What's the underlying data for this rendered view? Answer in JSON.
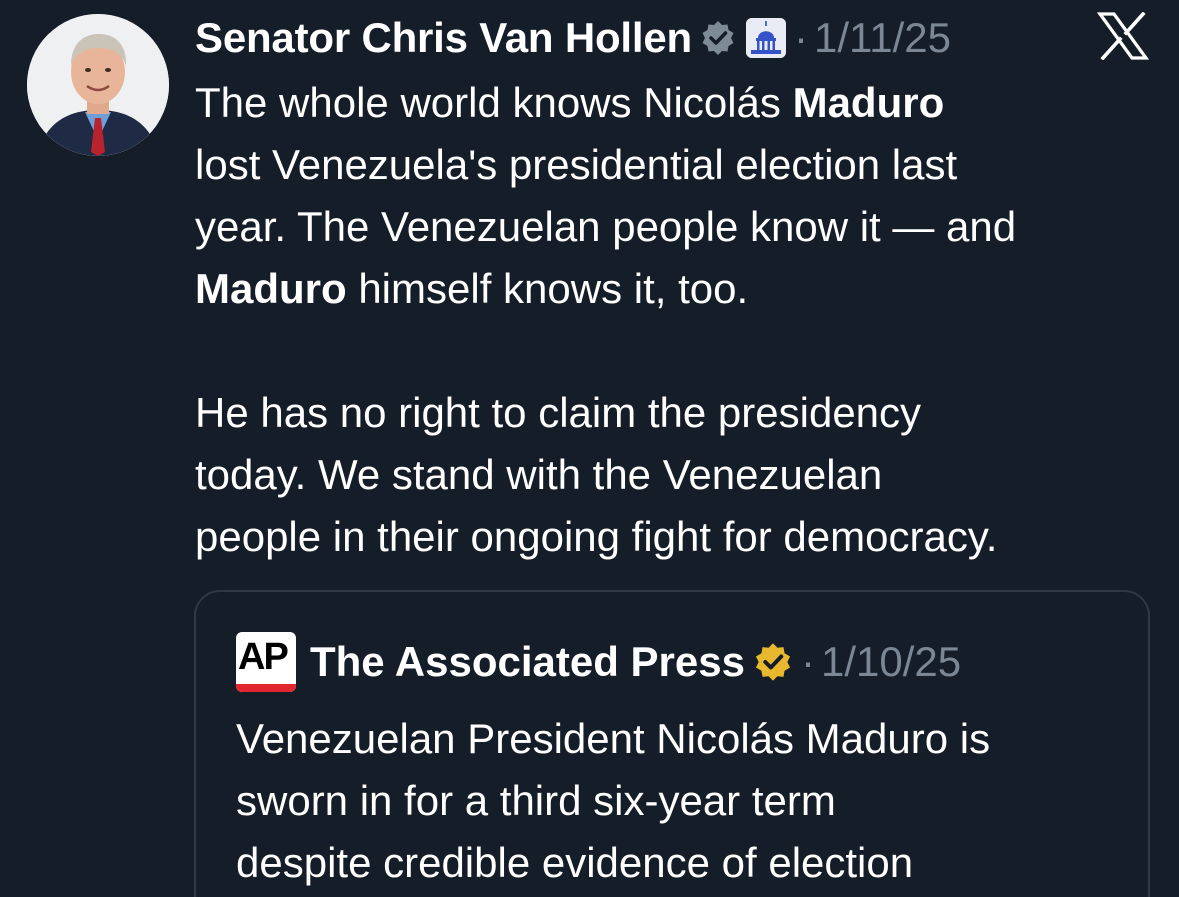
{
  "post": {
    "author_name": "Senator Chris Van Hollen",
    "separator": "·",
    "date": "1/11/25",
    "icons": {
      "verified_badge": "verified-gray-icon",
      "affiliation_badge": "capitol-icon",
      "platform_logo": "x-logo-icon"
    },
    "text_lines": [
      {
        "before": "The whole world knows Nicolás ",
        "bold": "Maduro",
        "after": ""
      },
      {
        "before": "lost Venezuela's presidential election last",
        "bold": "",
        "after": ""
      },
      {
        "before": "year. The Venezuelan people know it — and",
        "bold": "",
        "after": ""
      },
      {
        "before": "",
        "bold": "Maduro",
        "after": " himself knows it, too."
      },
      {
        "before": "",
        "bold": "",
        "after": ""
      },
      {
        "before": "He has no right to claim the presidency",
        "bold": "",
        "after": ""
      },
      {
        "before": "today. We stand with the Venezuelan",
        "bold": "",
        "after": ""
      },
      {
        "before": "people in their ongoing fight for democracy.",
        "bold": "",
        "after": ""
      }
    ]
  },
  "quoted_post": {
    "logo_text": "AP",
    "author_name": "The Associated Press",
    "separator": "·",
    "date": "1/10/25",
    "icons": {
      "verified_badge": "verified-gold-icon"
    },
    "text_lines": [
      "Venezuelan President Nicolás Maduro is",
      "sworn in for a third six-year term",
      "despite credible evidence of election"
    ]
  },
  "colors": {
    "background": "#151d28",
    "text_primary": "#ffffff",
    "text_secondary": "#7b8794",
    "card_border": "#2f3945",
    "gold_badge": "#e8b82e",
    "ap_red": "#e1262d"
  }
}
